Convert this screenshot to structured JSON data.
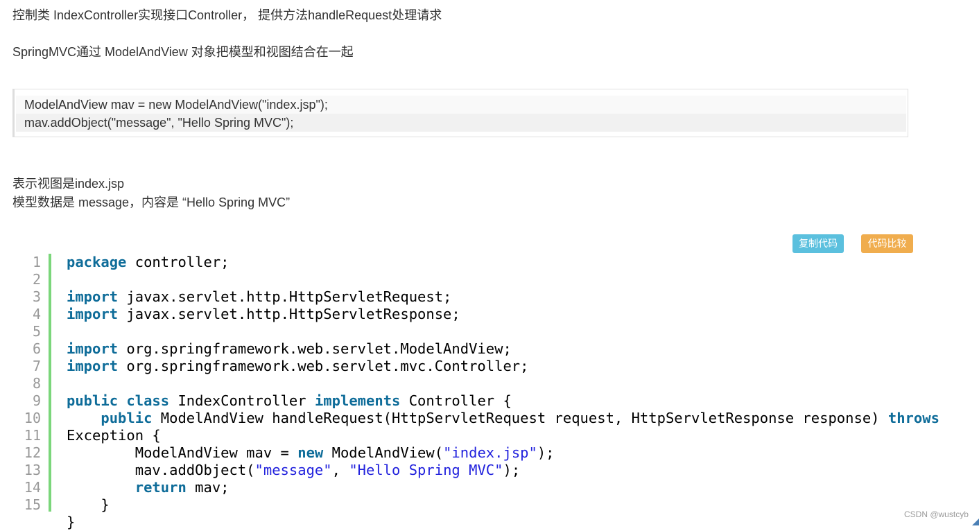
{
  "intro": {
    "line1": "控制类 IndexController实现接口Controller， 提供方法handleRequest处理请求",
    "line2": "SpringMVC通过 ModelAndView 对象把模型和视图结合在一起"
  },
  "quote": {
    "line1": "ModelAndView mav = new ModelAndView(\"index.jsp\");",
    "line2": "mav.addObject(\"message\", \"Hello Spring MVC\");"
  },
  "explain": {
    "line1": "表示视图是index.jsp",
    "line2": "模型数据是 message，内容是 “Hello Spring MVC”"
  },
  "toolbar": {
    "copy_label": "复制代码",
    "compare_label": "代码比较"
  },
  "code": {
    "lines": [
      {
        "n": "1",
        "t": [
          [
            "kw",
            "package"
          ],
          [
            "",
            "controller;"
          ]
        ]
      },
      {
        "n": "2",
        "t": []
      },
      {
        "n": "3",
        "t": [
          [
            "kw",
            "import"
          ],
          [
            "",
            "javax.servlet.http.HttpServletRequest;"
          ]
        ]
      },
      {
        "n": "4",
        "t": [
          [
            "kw",
            "import"
          ],
          [
            "",
            "javax.servlet.http.HttpServletResponse;"
          ]
        ]
      },
      {
        "n": "5",
        "t": []
      },
      {
        "n": "6",
        "t": [
          [
            "kw",
            "import"
          ],
          [
            "",
            "org.springframework.web.servlet.ModelAndView;"
          ]
        ]
      },
      {
        "n": "7",
        "t": [
          [
            "kw",
            "import"
          ],
          [
            "",
            "org.springframework.web.servlet.mvc.Controller;"
          ]
        ]
      },
      {
        "n": "8",
        "t": []
      },
      {
        "n": "9",
        "t": [
          [
            "kw",
            "public"
          ],
          [
            "",
            " "
          ],
          [
            "kw",
            "class"
          ],
          [
            "",
            "IndexController"
          ],
          [
            "kw",
            "implements"
          ],
          [
            "",
            "Controller {"
          ]
        ]
      },
      {
        "n": "10",
        "t": [
          [
            "",
            "    "
          ],
          [
            "kw",
            "public"
          ],
          [
            "",
            "ModelAndView handleRequest(HttpServletRequest request, HttpServletResponse response)"
          ],
          [
            "kw",
            "throws"
          ]
        ]
      },
      {
        "n": "11",
        "t": [
          [
            "",
            "Exception {"
          ]
        ]
      },
      {
        "n": "12",
        "t": [
          [
            "",
            "        ModelAndView mav = "
          ],
          [
            "kw",
            "new"
          ],
          [
            "",
            "ModelAndView("
          ],
          [
            "str",
            "\"index.jsp\""
          ],
          [
            "",
            ");"
          ]
        ]
      },
      {
        "n": "13",
        "t": [
          [
            "",
            "        mav.addObject("
          ],
          [
            "str",
            "\"message\""
          ],
          [
            "",
            ", "
          ],
          [
            "str",
            "\"Hello Spring MVC\""
          ],
          [
            "",
            ");"
          ]
        ]
      },
      {
        "n": "14",
        "t": [
          [
            "",
            "        "
          ],
          [
            "kw",
            "return"
          ],
          [
            "",
            "mav;"
          ]
        ]
      },
      {
        "n": "15",
        "t": [
          [
            "",
            "    }"
          ]
        ]
      },
      {
        "n": "",
        "t": [
          [
            "",
            "}"
          ]
        ]
      }
    ]
  },
  "watermark": "CSDN @wustcyb"
}
